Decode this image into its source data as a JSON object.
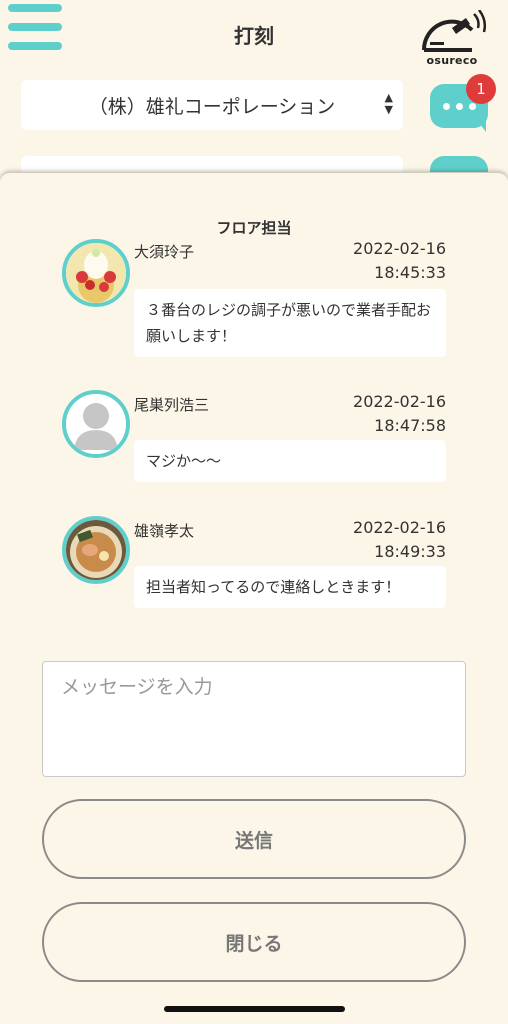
{
  "header": {
    "title": "打刻",
    "logo_text": "osureco",
    "menu_icon": "hamburger-icon"
  },
  "company_select": {
    "value": "（株）雄礼コーポレーション",
    "arrows": "▲▼"
  },
  "chat": {
    "icon": "chat-bubble-icon",
    "badge_count": "1"
  },
  "modal": {
    "room_title": "フロア担当",
    "messages": [
      {
        "sender": "大須玲子",
        "date": "2022-02-16",
        "time": "18:45:33",
        "body": "３番台のレジの調子が悪いので業者手配お願いします！",
        "avatar": "avatar-parfait-photo"
      },
      {
        "sender": "尾巣列浩三",
        "date": "2022-02-16",
        "time": "18:47:58",
        "body": "マジか〜〜",
        "avatar": "avatar-default-silhouette"
      },
      {
        "sender": "雄嶺孝太",
        "date": "2022-02-16",
        "time": "18:49:33",
        "body": "担当者知ってるので連絡しときます！",
        "avatar": "avatar-ramen-photo"
      }
    ],
    "input_placeholder": "メッセージを入力",
    "send_label": "送信",
    "close_label": "閉じる"
  },
  "colors": {
    "accent": "#5fcfcb",
    "background": "#fbf6e8",
    "badge": "#e03b3b"
  }
}
